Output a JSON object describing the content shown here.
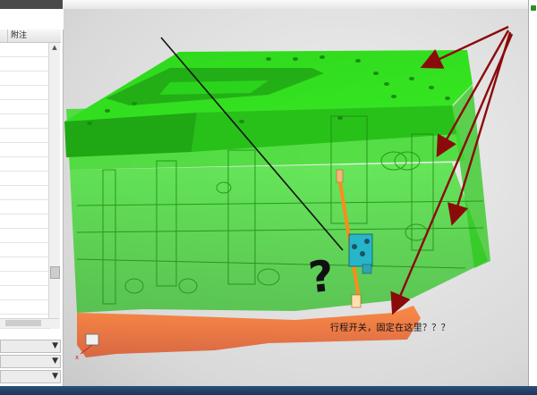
{
  "table": {
    "column_header": "附注"
  },
  "annotation": {
    "text": "行程开关，固定在这里？？？",
    "question_mark": "?"
  },
  "colors": {
    "mold_green": "#33e01e",
    "plate_dark_green": "#1f9e14",
    "arrow_red": "#8b0a0a",
    "rod_orange": "#ff8a1e",
    "switch_cyan": "#27b5c9"
  },
  "icons": {
    "dropdown": "chevron-down-icon",
    "scroll_up": "arrow-up-icon",
    "scroll_down": "arrow-down-icon"
  }
}
